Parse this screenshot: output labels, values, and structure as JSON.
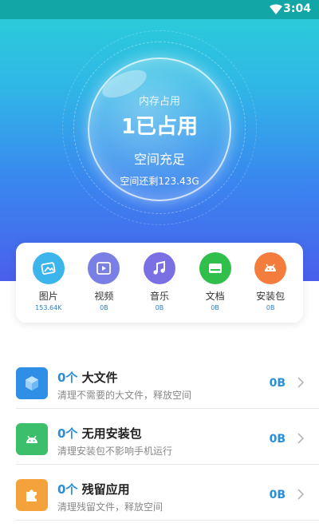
{
  "status_bar": {
    "time": "3:04"
  },
  "storage": {
    "caption": "内存占用",
    "value": "1已占用",
    "status": "空间充足",
    "remaining": "空间还剩123.43G"
  },
  "categories": [
    {
      "label": "图片",
      "size": "153.64K",
      "icon": "image-icon",
      "color": "#3cb4ec"
    },
    {
      "label": "视频",
      "size": "0B",
      "icon": "video-icon",
      "color": "#7a7fe6"
    },
    {
      "label": "音乐",
      "size": "0B",
      "icon": "music-icon",
      "color": "#7b6fe4"
    },
    {
      "label": "文档",
      "size": "0B",
      "icon": "drive-icon",
      "color": "#2fbf4a"
    },
    {
      "label": "安装包",
      "size": "0B",
      "icon": "android-icon",
      "color": "#f47c3c"
    }
  ],
  "list": [
    {
      "count": "0个",
      "title": "大文件",
      "desc": "清理不需要的大文件，释放空间",
      "size": "0B",
      "icon": "cube-icon",
      "color": "#2f8fe6"
    },
    {
      "count": "0个",
      "title": "无用安装包",
      "desc": "清理安装包不影响手机运行",
      "size": "0B",
      "icon": "android-icon",
      "color": "#3cbf6a"
    },
    {
      "count": "0个",
      "title": "残留应用",
      "desc": "清理残留文件，释放空间",
      "size": "0B",
      "icon": "puzzle-icon",
      "color": "#f4a33c"
    }
  ]
}
